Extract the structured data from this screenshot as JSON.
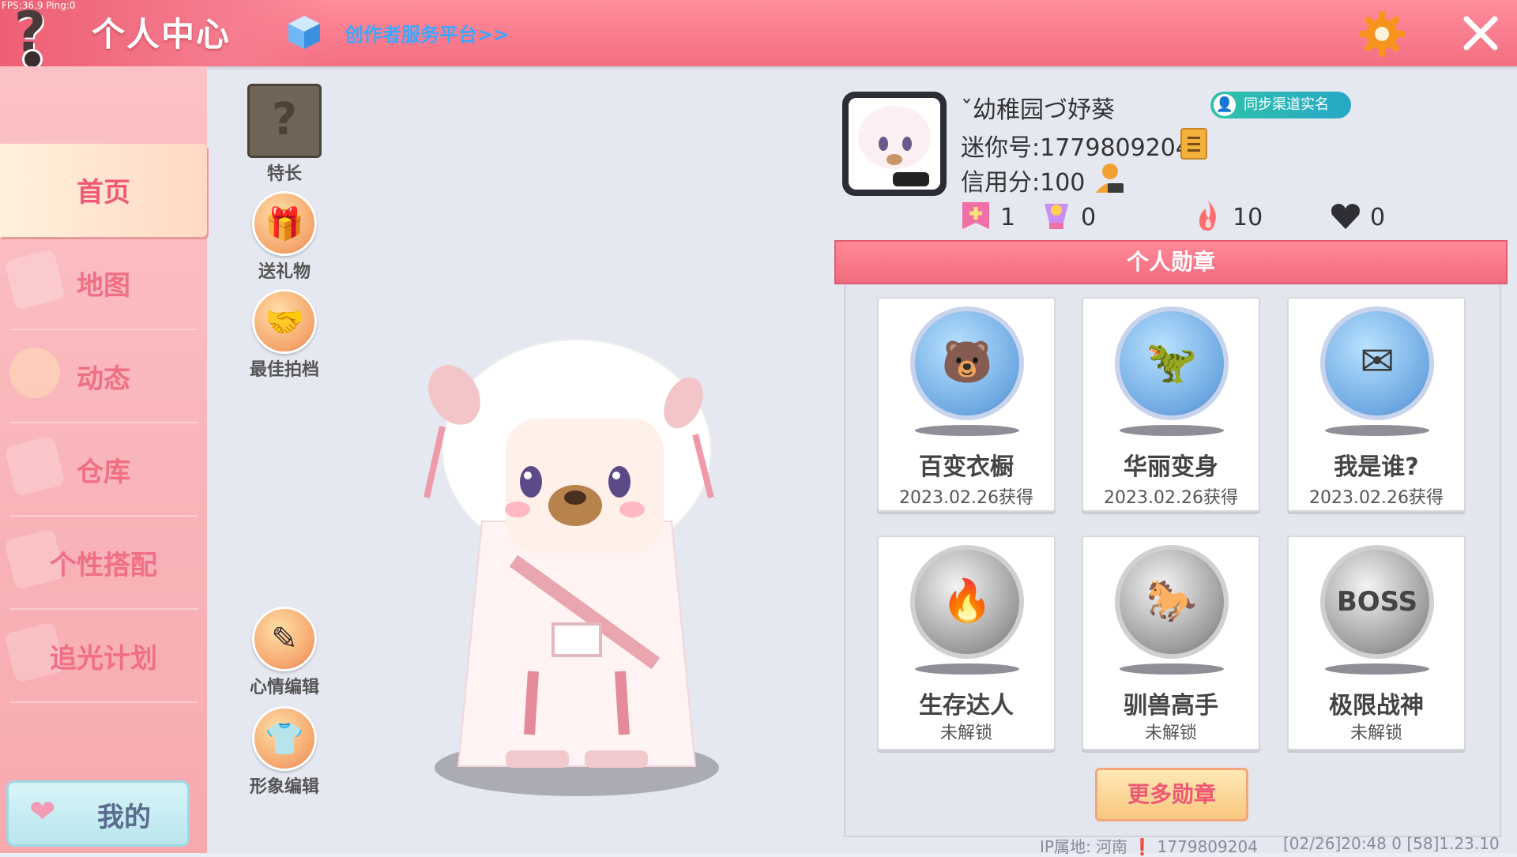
{
  "header": {
    "fps": "FPS:36.9  Ping:0",
    "title": "个人中心",
    "creator_link": "创作者服务平台>>",
    "help_icon": "?"
  },
  "sidebar": {
    "items": [
      {
        "label": "首页",
        "active": true
      },
      {
        "label": "地图"
      },
      {
        "label": "动态"
      },
      {
        "label": "仓库"
      },
      {
        "label": "个性搭配"
      },
      {
        "label": "追光计划"
      }
    ],
    "mine_label": "我的"
  },
  "actions": {
    "talent": "特长",
    "talent_glyph": "?",
    "gift": "送礼物",
    "best_photo": "最佳拍档",
    "mood_edit": "心情编辑",
    "image_edit": "形象编辑"
  },
  "profile": {
    "nickname": "ˇ幼稚园づ妤葵",
    "sync_label": "同步渠道实名",
    "mini_id": "迷你号:1779809204",
    "credit": "信用分:100",
    "stats": {
      "badge_count": "1",
      "trophy_count": "0",
      "fire_count": "10",
      "heart_count": "0"
    }
  },
  "medals": {
    "header": "个人勋章",
    "items": [
      {
        "name": "百变衣橱",
        "status": "2023.02.26获得",
        "unlocked": true,
        "icon": "wardrobe-medal-icon"
      },
      {
        "name": "华丽变身",
        "status": "2023.02.26获得",
        "unlocked": true,
        "icon": "transform-medal-icon"
      },
      {
        "name": "我是谁?",
        "status": "2023.02.26获得",
        "unlocked": true,
        "icon": "letter-medal-icon"
      },
      {
        "name": "生存达人",
        "status": "未解锁",
        "unlocked": false,
        "icon": "fire-medal-icon"
      },
      {
        "name": "驯兽高手",
        "status": "未解锁",
        "unlocked": false,
        "icon": "tamer-medal-icon"
      },
      {
        "name": "极限战神",
        "status": "未解锁",
        "unlocked": false,
        "icon": "boss-medal-icon",
        "glyph": "BOSS"
      }
    ],
    "more_label": "更多勋章"
  },
  "footer": {
    "ip": "IP属地: 河南 ❗ 1779809204",
    "debug": "[02/26]20:48 0  [58]1.23.10"
  },
  "colors": {
    "header": "#f36f82",
    "sidebar": "#f9b4b9",
    "accent_pink": "#f06f86",
    "link_blue": "#39a8ff",
    "sync_teal": "#2fc3a9"
  }
}
